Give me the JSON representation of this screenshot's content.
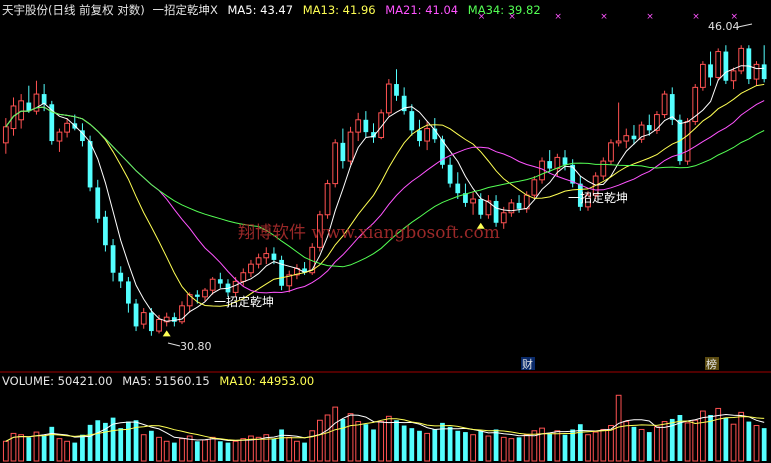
{
  "header": {
    "stock": "天宇股份(日线 前复权 对数)",
    "formula": "一招定乾坤X",
    "ma5_label": "MA5: 43.47",
    "ma13_label": "MA13: 41.96",
    "ma21_label": "MA21: 41.04",
    "ma34_label": "MA34: 39.82"
  },
  "volume_header": {
    "volume_label": "VOLUME: 50421.00",
    "ma5_label": "MA5: 51560.15",
    "ma10_label": "MA10: 44953.00"
  },
  "watermark": "翔博软件 www.xiangbosoft.com",
  "annotations": {
    "high_label": "46.04",
    "low_label": "30.80",
    "signal_label_1": "一招定乾坤",
    "signal_label_2": "一招定乾坤",
    "event_cai": "财",
    "event_bang": "榜"
  },
  "colors": {
    "up": "#ff5252",
    "down": "#54ffff",
    "ma5": "#ffffff",
    "ma13": "#ffff54",
    "ma21": "#ff54ff",
    "ma34": "#54ff54",
    "background": "#000000",
    "grid": "#7a0000",
    "header_text": "#e0e0e0"
  },
  "chart_data": [
    {
      "type": "candlestick",
      "title": "天宇股份(日线 前复权 对数)",
      "y_scale": "log",
      "ylim": [
        30.2,
        47.5
      ],
      "candles": [
        {
          "o": 40.2,
          "h": 41.6,
          "l": 39.6,
          "c": 41.1
        },
        {
          "o": 41.0,
          "h": 42.8,
          "l": 40.6,
          "c": 42.3
        },
        {
          "o": 41.5,
          "h": 43.0,
          "l": 41.0,
          "c": 42.6
        },
        {
          "o": 42.5,
          "h": 43.5,
          "l": 41.9,
          "c": 42.0
        },
        {
          "o": 42.0,
          "h": 43.8,
          "l": 41.8,
          "c": 43.0
        },
        {
          "o": 43.0,
          "h": 43.6,
          "l": 42.0,
          "c": 42.4
        },
        {
          "o": 42.4,
          "h": 42.6,
          "l": 40.1,
          "c": 40.3
        },
        {
          "o": 40.3,
          "h": 41.0,
          "l": 39.7,
          "c": 40.8
        },
        {
          "o": 40.8,
          "h": 41.6,
          "l": 40.5,
          "c": 41.3
        },
        {
          "o": 41.3,
          "h": 41.8,
          "l": 40.9,
          "c": 41.0
        },
        {
          "o": 40.9,
          "h": 41.3,
          "l": 40.0,
          "c": 40.3
        },
        {
          "o": 40.3,
          "h": 40.6,
          "l": 37.6,
          "c": 37.8
        },
        {
          "o": 37.8,
          "h": 38.2,
          "l": 36.0,
          "c": 36.2
        },
        {
          "o": 36.3,
          "h": 36.6,
          "l": 34.6,
          "c": 34.9
        },
        {
          "o": 34.9,
          "h": 35.2,
          "l": 33.2,
          "c": 33.6
        },
        {
          "o": 33.6,
          "h": 33.9,
          "l": 32.9,
          "c": 33.2
        },
        {
          "o": 33.2,
          "h": 33.4,
          "l": 31.8,
          "c": 32.2
        },
        {
          "o": 32.2,
          "h": 32.4,
          "l": 31.0,
          "c": 31.2
        },
        {
          "o": 31.3,
          "h": 32.0,
          "l": 31.1,
          "c": 31.8
        },
        {
          "o": 31.8,
          "h": 32.0,
          "l": 30.8,
          "c": 31.0
        },
        {
          "o": 31.0,
          "h": 31.7,
          "l": 30.9,
          "c": 31.5
        },
        {
          "o": 31.4,
          "h": 31.8,
          "l": 31.2,
          "c": 31.6
        },
        {
          "o": 31.6,
          "h": 31.8,
          "l": 31.2,
          "c": 31.4
        },
        {
          "o": 31.4,
          "h": 32.3,
          "l": 31.3,
          "c": 32.1
        },
        {
          "o": 32.1,
          "h": 32.7,
          "l": 31.8,
          "c": 32.6
        },
        {
          "o": 32.6,
          "h": 32.8,
          "l": 32.2,
          "c": 32.5
        },
        {
          "o": 32.5,
          "h": 32.9,
          "l": 32.3,
          "c": 32.8
        },
        {
          "o": 32.8,
          "h": 33.4,
          "l": 32.6,
          "c": 33.3
        },
        {
          "o": 33.3,
          "h": 33.6,
          "l": 32.9,
          "c": 33.1
        },
        {
          "o": 33.1,
          "h": 33.3,
          "l": 32.5,
          "c": 32.7
        },
        {
          "o": 32.7,
          "h": 33.4,
          "l": 32.5,
          "c": 33.2
        },
        {
          "o": 33.2,
          "h": 33.8,
          "l": 33.0,
          "c": 33.6
        },
        {
          "o": 33.6,
          "h": 34.2,
          "l": 33.4,
          "c": 34.0
        },
        {
          "o": 34.0,
          "h": 34.5,
          "l": 33.8,
          "c": 34.3
        },
        {
          "o": 34.3,
          "h": 34.8,
          "l": 34.0,
          "c": 34.5
        },
        {
          "o": 34.5,
          "h": 34.8,
          "l": 34.0,
          "c": 34.2
        },
        {
          "o": 34.2,
          "h": 34.4,
          "l": 32.8,
          "c": 33.0
        },
        {
          "o": 33.0,
          "h": 33.7,
          "l": 32.7,
          "c": 33.5
        },
        {
          "o": 33.5,
          "h": 34.0,
          "l": 33.3,
          "c": 33.8
        },
        {
          "o": 33.8,
          "h": 34.1,
          "l": 33.5,
          "c": 33.6
        },
        {
          "o": 33.6,
          "h": 35.0,
          "l": 33.5,
          "c": 34.8
        },
        {
          "o": 34.8,
          "h": 36.6,
          "l": 34.6,
          "c": 36.4
        },
        {
          "o": 36.4,
          "h": 38.2,
          "l": 36.2,
          "c": 38.0
        },
        {
          "o": 38.0,
          "h": 40.4,
          "l": 37.8,
          "c": 40.2
        },
        {
          "o": 40.2,
          "h": 41.0,
          "l": 38.8,
          "c": 39.2
        },
        {
          "o": 39.2,
          "h": 41.1,
          "l": 39.0,
          "c": 40.8
        },
        {
          "o": 40.8,
          "h": 41.9,
          "l": 40.3,
          "c": 41.5
        },
        {
          "o": 41.5,
          "h": 42.0,
          "l": 40.5,
          "c": 40.8
        },
        {
          "o": 40.8,
          "h": 41.3,
          "l": 40.2,
          "c": 40.5
        },
        {
          "o": 40.5,
          "h": 42.1,
          "l": 40.4,
          "c": 41.9
        },
        {
          "o": 41.9,
          "h": 43.9,
          "l": 41.7,
          "c": 43.6
        },
        {
          "o": 43.6,
          "h": 44.5,
          "l": 42.6,
          "c": 42.9
        },
        {
          "o": 42.9,
          "h": 43.4,
          "l": 41.8,
          "c": 42.0
        },
        {
          "o": 42.0,
          "h": 42.4,
          "l": 40.6,
          "c": 40.9
        },
        {
          "o": 40.9,
          "h": 41.5,
          "l": 40.0,
          "c": 40.3
        },
        {
          "o": 40.3,
          "h": 41.4,
          "l": 39.8,
          "c": 41.0
        },
        {
          "o": 41.0,
          "h": 41.6,
          "l": 40.2,
          "c": 40.4
        },
        {
          "o": 40.4,
          "h": 40.6,
          "l": 38.8,
          "c": 39.0
        },
        {
          "o": 39.0,
          "h": 39.4,
          "l": 37.8,
          "c": 38.0
        },
        {
          "o": 38.0,
          "h": 38.6,
          "l": 37.2,
          "c": 37.5
        },
        {
          "o": 37.5,
          "h": 38.0,
          "l": 36.8,
          "c": 37.0
        },
        {
          "o": 37.0,
          "h": 37.6,
          "l": 36.4,
          "c": 37.2
        },
        {
          "o": 37.2,
          "h": 37.5,
          "l": 36.2,
          "c": 36.4
        },
        {
          "o": 36.4,
          "h": 37.4,
          "l": 36.2,
          "c": 37.1
        },
        {
          "o": 37.1,
          "h": 37.4,
          "l": 35.8,
          "c": 36.0
        },
        {
          "o": 36.0,
          "h": 36.8,
          "l": 35.7,
          "c": 36.5
        },
        {
          "o": 36.5,
          "h": 37.2,
          "l": 36.3,
          "c": 37.0
        },
        {
          "o": 37.0,
          "h": 37.4,
          "l": 36.5,
          "c": 36.7
        },
        {
          "o": 36.7,
          "h": 37.6,
          "l": 36.5,
          "c": 37.4
        },
        {
          "o": 37.4,
          "h": 38.4,
          "l": 37.2,
          "c": 38.2
        },
        {
          "o": 38.2,
          "h": 39.4,
          "l": 38.0,
          "c": 39.2
        },
        {
          "o": 39.2,
          "h": 39.8,
          "l": 38.6,
          "c": 38.8
        },
        {
          "o": 38.8,
          "h": 39.6,
          "l": 38.4,
          "c": 39.4
        },
        {
          "o": 39.4,
          "h": 39.8,
          "l": 38.7,
          "c": 39.0
        },
        {
          "o": 39.0,
          "h": 39.3,
          "l": 37.8,
          "c": 38.0
        },
        {
          "o": 38.0,
          "h": 38.4,
          "l": 36.6,
          "c": 36.8
        },
        {
          "o": 36.8,
          "h": 37.6,
          "l": 36.6,
          "c": 37.4
        },
        {
          "o": 37.4,
          "h": 38.6,
          "l": 37.2,
          "c": 38.4
        },
        {
          "o": 38.4,
          "h": 39.4,
          "l": 38.2,
          "c": 39.2
        },
        {
          "o": 39.2,
          "h": 40.4,
          "l": 39.0,
          "c": 40.2
        },
        {
          "o": 40.2,
          "h": 42.5,
          "l": 40.0,
          "c": 40.3
        },
        {
          "o": 40.3,
          "h": 41.0,
          "l": 39.9,
          "c": 40.6
        },
        {
          "o": 40.6,
          "h": 41.2,
          "l": 40.1,
          "c": 40.4
        },
        {
          "o": 40.4,
          "h": 41.4,
          "l": 40.2,
          "c": 41.2
        },
        {
          "o": 41.2,
          "h": 41.8,
          "l": 40.6,
          "c": 40.9
        },
        {
          "o": 40.9,
          "h": 42.0,
          "l": 40.7,
          "c": 41.8
        },
        {
          "o": 41.8,
          "h": 43.2,
          "l": 41.6,
          "c": 43.0
        },
        {
          "o": 43.0,
          "h": 43.4,
          "l": 41.2,
          "c": 41.5
        },
        {
          "o": 41.5,
          "h": 41.8,
          "l": 39.0,
          "c": 39.2
        },
        {
          "o": 39.2,
          "h": 41.6,
          "l": 39.0,
          "c": 41.4
        },
        {
          "o": 41.4,
          "h": 43.6,
          "l": 41.2,
          "c": 43.4
        },
        {
          "o": 43.4,
          "h": 45.0,
          "l": 43.2,
          "c": 44.8
        },
        {
          "o": 44.8,
          "h": 45.6,
          "l": 43.5,
          "c": 44.0
        },
        {
          "o": 44.0,
          "h": 45.8,
          "l": 43.8,
          "c": 45.6
        },
        {
          "o": 45.6,
          "h": 46.0,
          "l": 43.6,
          "c": 43.8
        },
        {
          "o": 43.8,
          "h": 44.6,
          "l": 43.3,
          "c": 44.4
        },
        {
          "o": 44.4,
          "h": 46.0,
          "l": 44.2,
          "c": 45.8
        },
        {
          "o": 45.8,
          "h": 46.0,
          "l": 43.6,
          "c": 43.9
        },
        {
          "o": 43.9,
          "h": 45.0,
          "l": 43.5,
          "c": 44.8
        },
        {
          "o": 44.8,
          "h": 46.0,
          "l": 43.7,
          "c": 43.9
        }
      ],
      "ma_series": [
        {
          "name": "MA5",
          "period": 5,
          "color": "#ffffff"
        },
        {
          "name": "MA13",
          "period": 13,
          "color": "#ffff54"
        },
        {
          "name": "MA21",
          "period": 21,
          "color": "#ff54ff"
        },
        {
          "name": "MA34",
          "period": 34,
          "color": "#54ff54"
        }
      ],
      "signals": [
        21,
        62
      ],
      "grid": false
    },
    {
      "type": "bar",
      "title": "VOLUME",
      "values": [
        30,
        42,
        40,
        36,
        44,
        38,
        52,
        34,
        30,
        28,
        40,
        55,
        62,
        58,
        66,
        50,
        60,
        62,
        40,
        46,
        36,
        30,
        28,
        34,
        38,
        30,
        32,
        36,
        30,
        28,
        30,
        34,
        38,
        36,
        40,
        34,
        48,
        36,
        30,
        28,
        46,
        62,
        70,
        82,
        64,
        72,
        60,
        56,
        48,
        60,
        68,
        62,
        54,
        50,
        46,
        42,
        48,
        58,
        52,
        46,
        44,
        40,
        46,
        38,
        48,
        36,
        34,
        36,
        40,
        46,
        50,
        42,
        46,
        40,
        48,
        56,
        40,
        44,
        48,
        54,
        100,
        60,
        52,
        48,
        44,
        52,
        60,
        64,
        70,
        58,
        62,
        76,
        70,
        80,
        66,
        56,
        74,
        60,
        54,
        50
      ],
      "ma_series": [
        {
          "name": "MA5",
          "period": 5,
          "color": "#ffffff"
        },
        {
          "name": "MA10",
          "period": 10,
          "color": "#ffff54"
        }
      ],
      "grid": false
    }
  ]
}
